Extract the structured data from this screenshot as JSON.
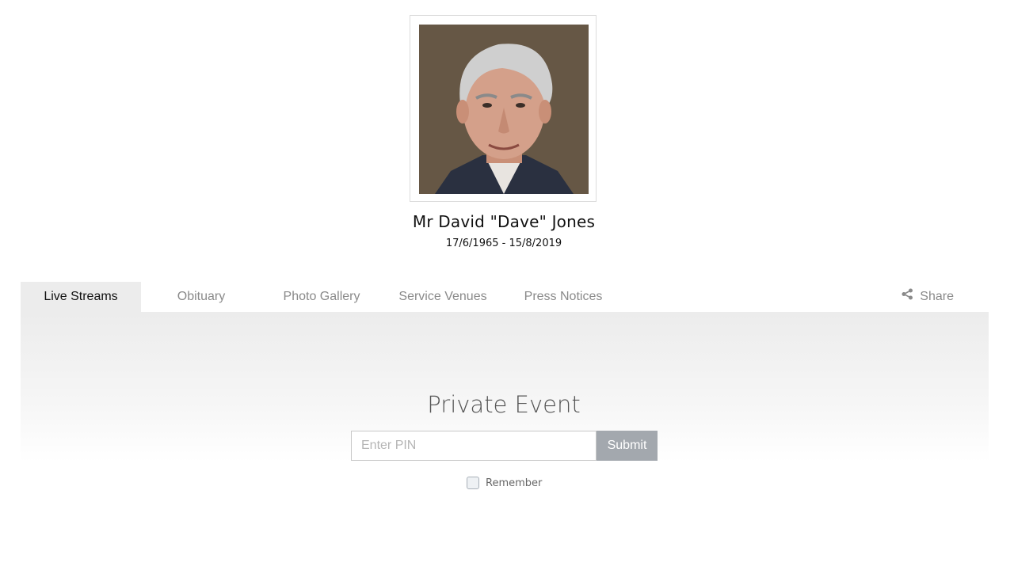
{
  "profile": {
    "name": "Mr David \"Dave\" Jones",
    "dates": "17/6/1965 - 15/8/2019"
  },
  "tabs": [
    {
      "label": "Live Streams",
      "active": true
    },
    {
      "label": "Obituary",
      "active": false
    },
    {
      "label": "Photo Gallery",
      "active": false
    },
    {
      "label": "Service Venues",
      "active": false
    },
    {
      "label": "Press Notices",
      "active": false
    }
  ],
  "share": {
    "label": "Share",
    "icon": "share-icon"
  },
  "event": {
    "title": "Private Event",
    "pin_placeholder": "Enter PIN",
    "pin_value": "",
    "submit_label": "Submit",
    "remember_label": "Remember",
    "remember_checked": false
  },
  "colors": {
    "active_tab_bg": "#ececec",
    "submit_bg": "#a3a8ae",
    "inactive_tab_text": "#8a8a8a"
  }
}
